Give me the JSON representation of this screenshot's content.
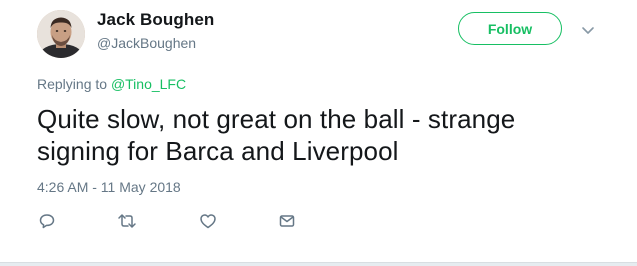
{
  "user": {
    "display_name": "Jack Boughen",
    "handle": "@JackBoughen"
  },
  "header": {
    "follow_label": "Follow",
    "menu_icon": "chevron-down-icon"
  },
  "reply": {
    "prefix": "Replying to ",
    "target": "@Tino_LFC"
  },
  "tweet": {
    "text": "Quite slow, not great on the ball - strange signing for Barca and Liverpool",
    "timestamp": "4:26 AM - 11 May 2018"
  },
  "actions": {
    "reply_icon": "reply-icon",
    "retweet_icon": "retweet-icon",
    "like_icon": "heart-icon",
    "dm_icon": "envelope-icon"
  },
  "colors": {
    "accent": "#17bf63",
    "text": "#14171a",
    "muted": "#657786",
    "icon": "#657786"
  }
}
